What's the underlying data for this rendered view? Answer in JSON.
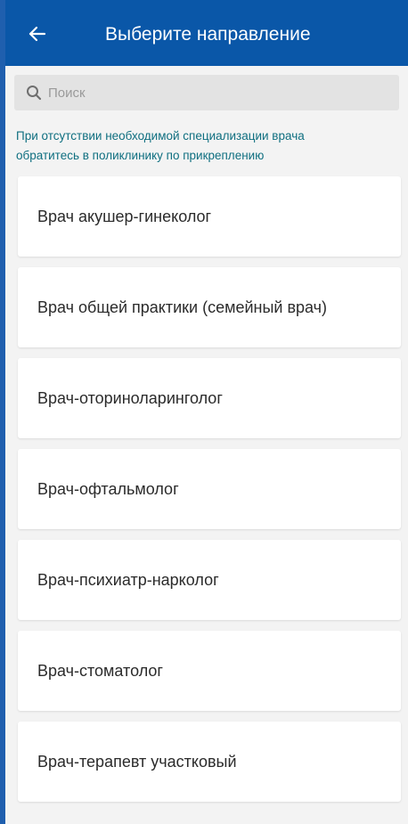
{
  "header": {
    "title": "Выберите направление",
    "back_icon": "arrow-left-icon"
  },
  "search": {
    "placeholder": "Поиск",
    "value": "",
    "icon": "search-icon"
  },
  "notice": {
    "line1": "При отсутствии необходимой специализации врача",
    "line2": "обратитесь в поликлинику по прикреплению"
  },
  "specialties": [
    {
      "label": "Врач акушер-гинеколог"
    },
    {
      "label": "Врач общей практики (семейный врач)"
    },
    {
      "label": "Врач-оториноларинголог"
    },
    {
      "label": "Врач-офтальмолог"
    },
    {
      "label": "Врач-психиатр-нарколог"
    },
    {
      "label": "Врач-стоматолог"
    },
    {
      "label": "Врач-терапевт участковый"
    }
  ],
  "colors": {
    "header_bg": "#0a57a8",
    "notice_text": "#0f6f80",
    "background": "#f3f3f3"
  }
}
